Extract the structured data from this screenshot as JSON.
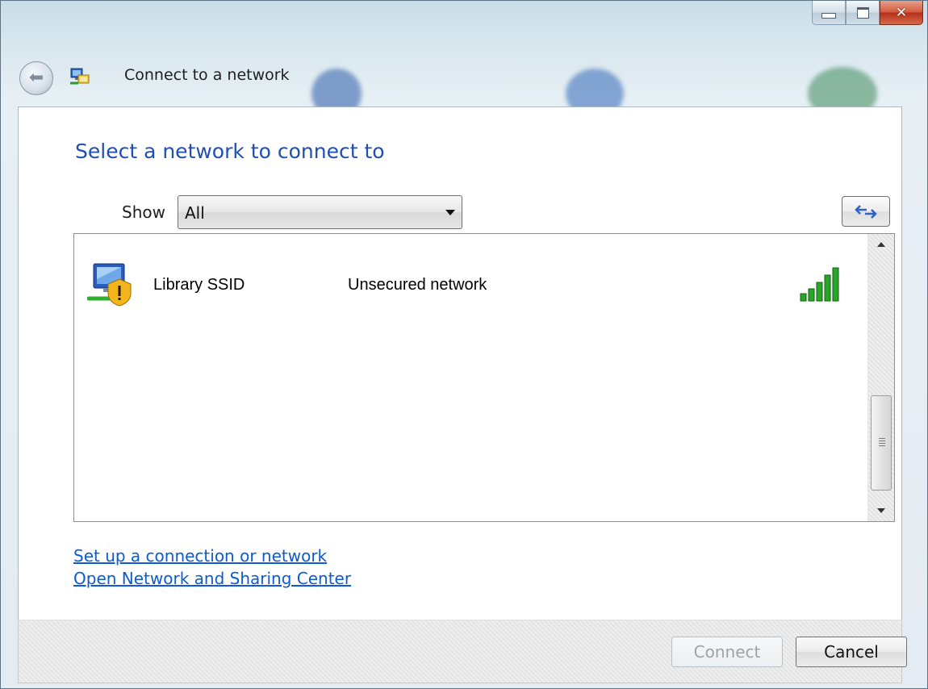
{
  "window": {
    "title": "Connect to a network"
  },
  "main": {
    "heading": "Select a network to connect to",
    "show_label": "Show",
    "show_value": "All"
  },
  "networks": [
    {
      "name": "Library SSID",
      "security": "Unsecured network",
      "signal_bars": 5
    }
  ],
  "links": {
    "setup": "Set up a connection or network",
    "sharing_center": "Open Network and Sharing Center"
  },
  "buttons": {
    "connect": "Connect",
    "cancel": "Cancel"
  },
  "colors": {
    "heading": "#1f4eb5",
    "link": "#0d5bd0",
    "signal": "#1e9a1e"
  },
  "icons": {
    "back": "back-arrow-icon",
    "title": "network-wizard-icon",
    "refresh": "refresh-icon",
    "network": "unsecured-wireless-network-icon",
    "signal": "signal-strength-icon"
  }
}
